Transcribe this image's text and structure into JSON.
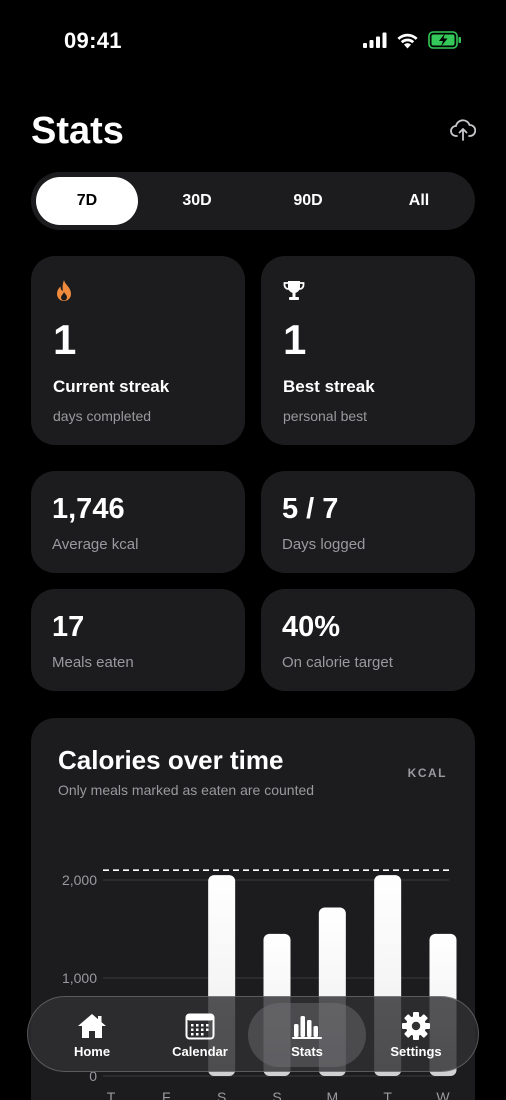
{
  "status_bar": {
    "time": "09:41"
  },
  "header": {
    "title": "Stats",
    "upload_icon": "cloud-upload-icon"
  },
  "range": {
    "options": [
      "7D",
      "30D",
      "90D",
      "All"
    ],
    "selected": "7D"
  },
  "streaks": {
    "current": {
      "icon": "flame-icon",
      "value": "1",
      "label": "Current streak",
      "sub": "days completed",
      "icon_color": "#f08a3c"
    },
    "best": {
      "icon": "trophy-icon",
      "value": "1",
      "label": "Best streak",
      "sub": "personal best"
    }
  },
  "stats": {
    "avg_kcal": {
      "value": "1,746",
      "label": "Average kcal"
    },
    "days_logged": {
      "value": "5 / 7",
      "label": "Days logged"
    },
    "meals": {
      "value": "17",
      "label": "Meals eaten"
    },
    "on_target": {
      "value": "40%",
      "label": "On calorie target"
    }
  },
  "chart": {
    "title": "Calories over time",
    "subtitle": "Only meals marked as eaten are counted",
    "unit": "KCAL"
  },
  "chart_data": {
    "type": "bar",
    "title": "Calories over time",
    "categories": [
      "T",
      "F",
      "S",
      "S",
      "M",
      "T",
      "W"
    ],
    "values": [
      0,
      0,
      2050,
      1450,
      1720,
      2050,
      1450
    ],
    "target": 2100,
    "ylim": [
      0,
      2100
    ],
    "yticks": [
      "0",
      "1,000",
      "2,000"
    ],
    "ytick_values": [
      0,
      1000,
      2000
    ],
    "grid": true,
    "ylabel": "KCAL"
  },
  "tabbar": {
    "items": [
      {
        "label": "Home",
        "icon": "home-icon"
      },
      {
        "label": "Calendar",
        "icon": "calendar-icon"
      },
      {
        "label": "Stats",
        "icon": "bar-chart-icon"
      },
      {
        "label": "Settings",
        "icon": "gear-icon"
      }
    ],
    "active": "Stats"
  }
}
